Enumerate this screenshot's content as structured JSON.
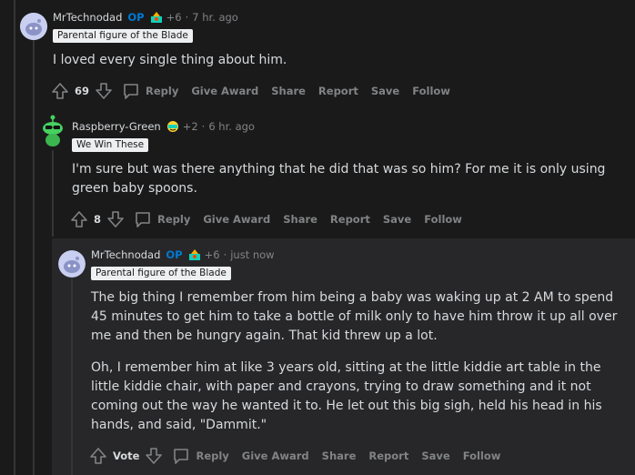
{
  "comments": [
    {
      "username": "MrTechnodad",
      "op_badge": "OP",
      "more_awards": "+6",
      "time": "7 hr. ago",
      "flair": "Parental figure of the Blade",
      "body": [
        "I loved every single thing about him."
      ],
      "vote_count": "69",
      "actions": {
        "reply": "Reply",
        "give_award": "Give Award",
        "share": "Share",
        "report": "Report",
        "save": "Save",
        "follow": "Follow"
      }
    },
    {
      "username": "Raspberry-Green",
      "more_awards": "+2",
      "time": "6 hr. ago",
      "flair": "We Win These",
      "body": [
        "I'm sure but was there anything that he did that was so him? For me it is only using green baby spoons."
      ],
      "vote_count": "8",
      "actions": {
        "reply": "Reply",
        "give_award": "Give Award",
        "share": "Share",
        "report": "Report",
        "save": "Save",
        "follow": "Follow"
      }
    },
    {
      "username": "MrTechnodad",
      "op_badge": "OP",
      "more_awards": "+6",
      "time": "just now",
      "flair": "Parental figure of the Blade",
      "body": [
        "The big thing I remember from him being a baby was waking up at 2 AM to spend 45 minutes to get him to take a bottle of milk only to have him throw it up all over me and then be hungry again. That kid threw up a lot.",
        "Oh, I remember him at like 3 years old, sitting at the little kiddie art table in the little kiddie chair, with paper and crayons, trying to draw something and it not coming out the way he wanted it to. He let out this big sigh, held his head in his hands, and said, \"Dammit.\""
      ],
      "vote_count": "Vote",
      "actions": {
        "reply": "Reply",
        "give_award": "Give Award",
        "share": "Share",
        "report": "Report",
        "save": "Save",
        "follow": "Follow"
      }
    }
  ],
  "colors": {
    "background": "#1a1a1b",
    "op": "#0079d3",
    "muted": "#818384",
    "text": "#d7dadc",
    "highlight": "#272729"
  },
  "icons": [
    "snoo-avatar-icon",
    "green-snoo-avatar-icon",
    "award-icon",
    "upvote-icon",
    "downvote-icon",
    "comment-bubble-icon"
  ]
}
